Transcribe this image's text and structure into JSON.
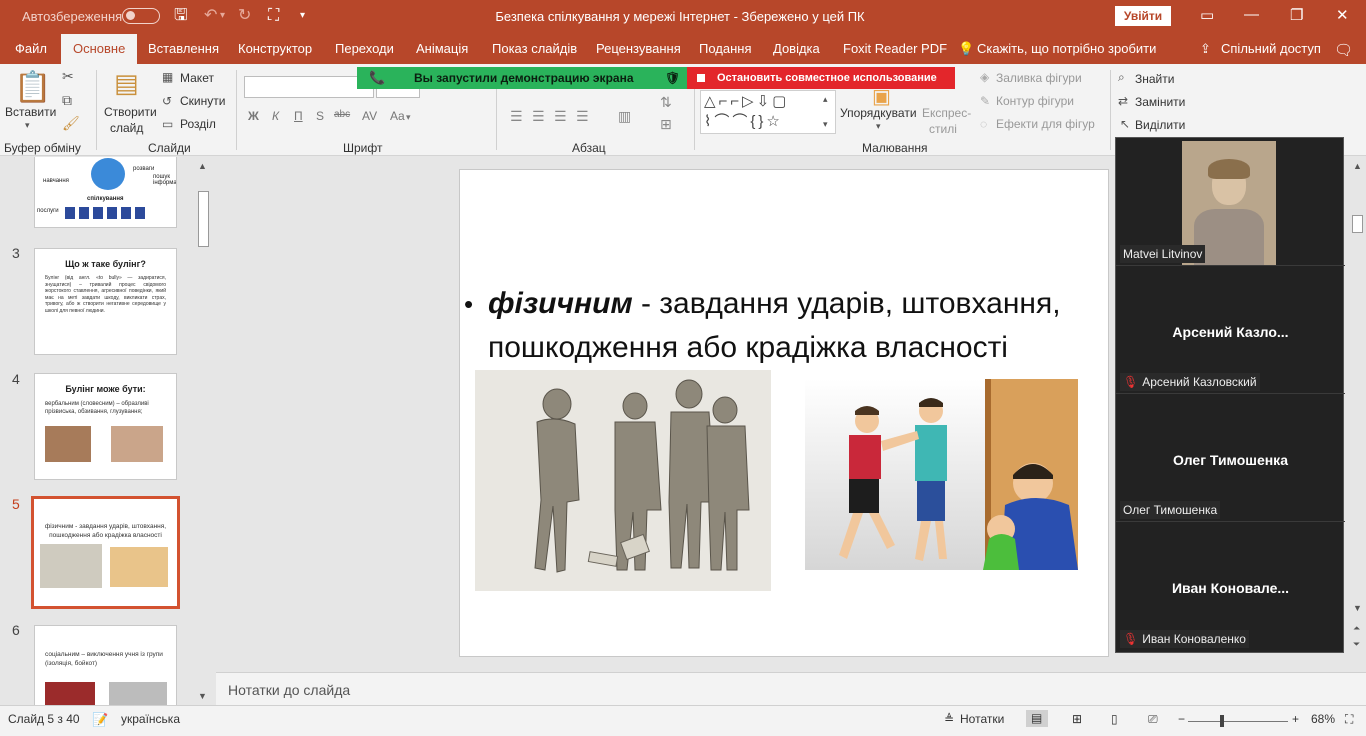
{
  "titlebar": {
    "autosave_label": "Автозбереження",
    "document_title": "Безпека спілкування у мережі Інтернет  -  Збережено у цей ПК",
    "signin_label": "Увійти"
  },
  "tabs": [
    "Файл",
    "Основне",
    "Вставлення",
    "Конструктор",
    "Переходи",
    "Анімація",
    "Показ слайдів",
    "Рецензування",
    "Подання",
    "Довідка",
    "Foxit Reader PDF",
    "Скажіть, що потрібно зробити",
    "Спільний доступ"
  ],
  "ribbon": {
    "paste": "Вставити",
    "clipboard_group": "Буфер обміну",
    "new_slide_line1": "Створити",
    "new_slide_line2": "слайд",
    "layout": "Макет",
    "reset": "Скинути",
    "section": "Розділ",
    "slides_group": "Слайди",
    "font_group": "Шрифт",
    "paragraph_group": "Абзац",
    "arrange": "Упорядкувати",
    "quick_styles_line1": "Експрес-",
    "quick_styles_line2": "стилі",
    "shape_fill": "Заливка фігури",
    "shape_outline": "Контур фігури",
    "shape_effects": "Ефекти для фігур",
    "drawing_group": "Малювання",
    "find": "Знайти",
    "replace": "Замінити",
    "select": "Виділити",
    "font_buttons": [
      "Ж",
      "К",
      "П",
      "abc",
      "AV",
      "Aa"
    ]
  },
  "share_bar": {
    "sharing_text": "Вы запустили демонстрацию экрана",
    "stop_text": "Остановить совместное использование"
  },
  "thumbnails": [
    {
      "num": "3",
      "title": "Що ж таке булінг?",
      "text": "Булінг (від англ. «to bully» — задиратися, знущатися) – тривалий процес свідомого жорстокого ставлення, агресивної поведінки, який має на меті завдати шкоду, викликати страх, тривогу, або ж створити негативне середовище у школі для певної людини."
    },
    {
      "num": "4",
      "title": "Булінг може бути:",
      "text": "вербальним (словесним) – образливі прізвиська, обзивання, глузування;"
    },
    {
      "num": "5",
      "title": "",
      "text": "фізичним - завдання ударів, штовхання, пошкодження або крадіжка власності"
    },
    {
      "num": "6",
      "title": "",
      "text": "соціальним – виключення учня із групи (ізоляція, бойкот)"
    }
  ],
  "first_thumb_words": [
    "навчання",
    "розваги",
    "спілкування",
    "пошук інформації",
    "послуги",
    "захоплення"
  ],
  "slide": {
    "bullet": "•",
    "bold_word": "фізичним",
    "line1_rest": " - завдання ударів, штовхання,",
    "line2": "пошкодження або крадіжка власності"
  },
  "video_panel": {
    "participants": [
      {
        "display": "",
        "label": "Matvei Litvinov",
        "muted": false
      },
      {
        "display": "Арсений  Казло...",
        "label": "Арсений Казловский",
        "muted": true
      },
      {
        "display": "Олег Тимошенка",
        "label": "Олег Тимошенка",
        "muted": false
      },
      {
        "display": "Иван  Коновале...",
        "label": "Иван Коноваленко",
        "muted": true
      }
    ]
  },
  "notes_placeholder": "Нотатки до слайда",
  "statusbar": {
    "slide_counter": "Слайд 5 з 40",
    "language": "українська",
    "notes_button": "Нотатки",
    "zoom": "68%"
  },
  "colors": {
    "accent": "#b7472a",
    "share_green": "#2ab35b",
    "share_red": "#e3262b",
    "active_thumb_border": "#d35230"
  }
}
